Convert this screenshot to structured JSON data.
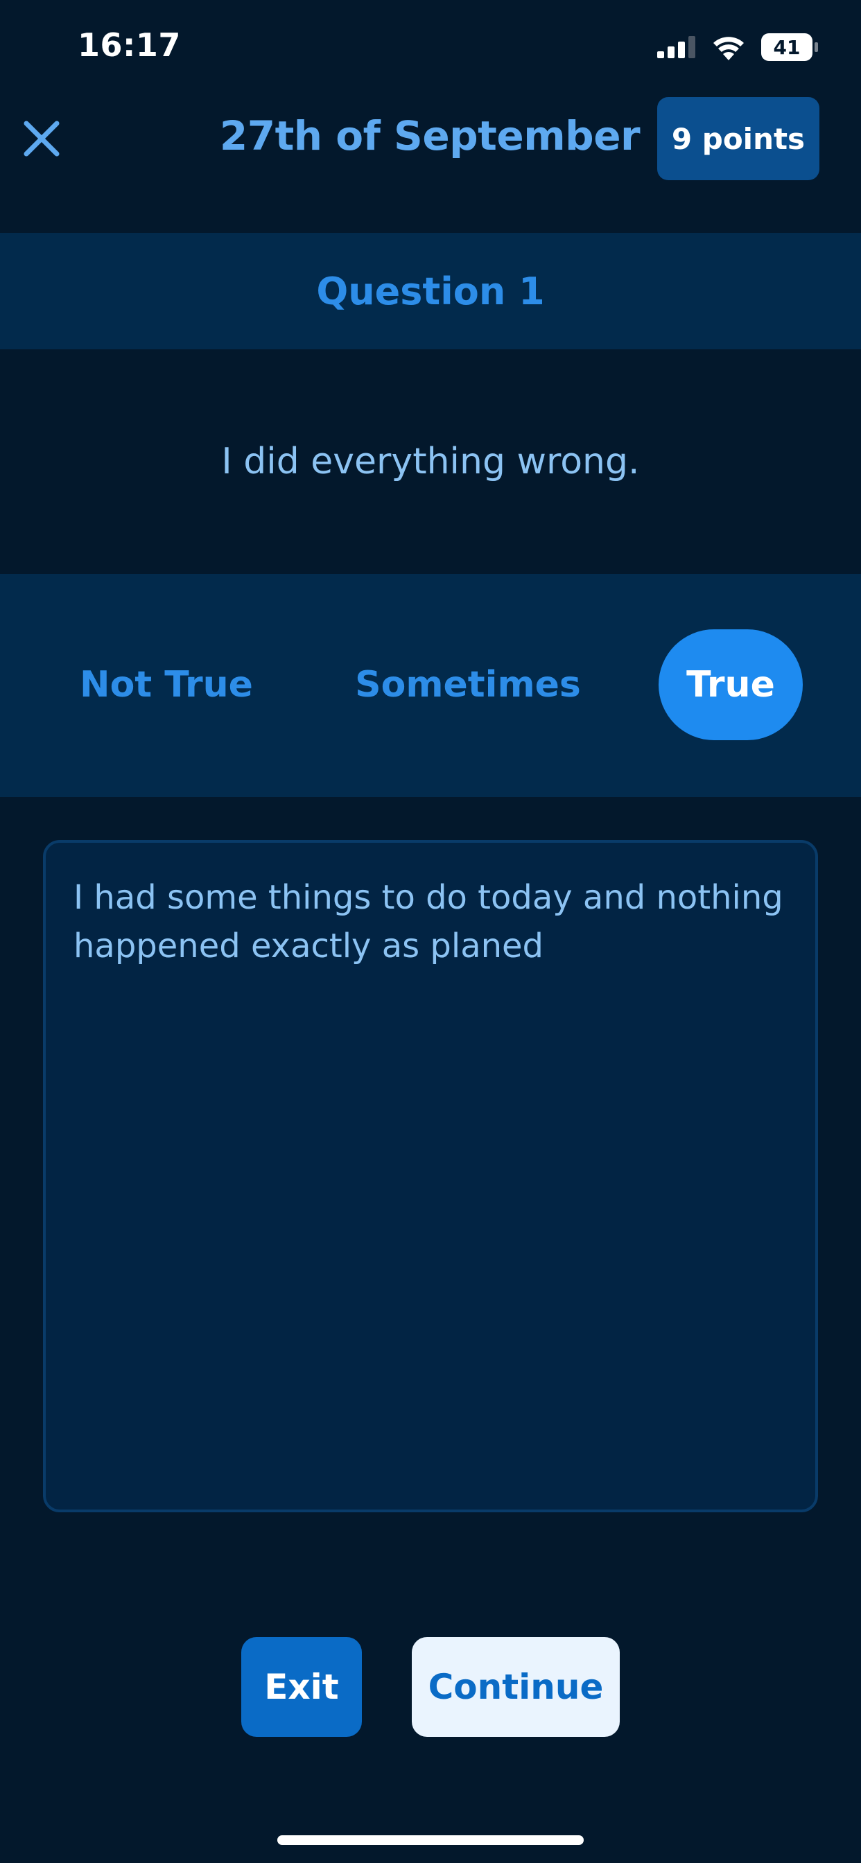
{
  "status_bar": {
    "time": "16:17",
    "battery": "41",
    "icons": [
      "signal-icon",
      "wifi-icon",
      "battery-icon"
    ]
  },
  "header": {
    "close_icon": "close-icon",
    "title": "27th of September",
    "points": "9 points"
  },
  "question": {
    "label": "Question 1",
    "statement": "I did everything wrong."
  },
  "options": {
    "items": [
      "Not True",
      "Sometimes",
      "True"
    ],
    "selected": "True"
  },
  "journal": {
    "value": "I had some things to do today and nothing happened exactly as planed"
  },
  "footer": {
    "exit_label": "Exit",
    "continue_label": "Continue"
  },
  "colors": {
    "background": "#03182c",
    "band": "#022a4c",
    "accent": "#1e8bf0",
    "accent_text": "#2d8de8",
    "title_text": "#5ea9f0",
    "body_text": "#8cc3f3",
    "points_badge": "#0b4f8f",
    "exit_button": "#0a6bc6",
    "continue_button": "#eaf4fe"
  }
}
